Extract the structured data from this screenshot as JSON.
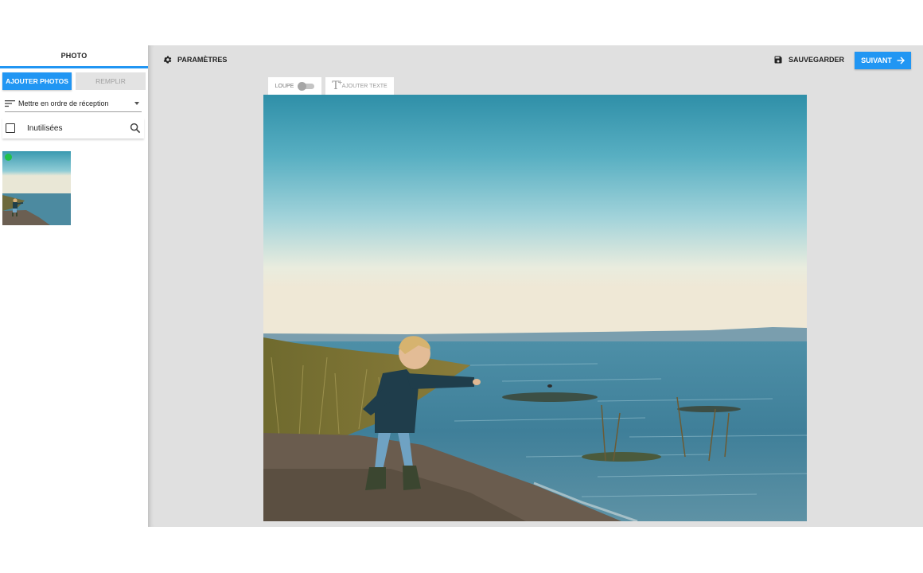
{
  "sidebar": {
    "tab_label": "PHOTO",
    "add_photos_label": "AJOUTER PHOTOS",
    "fill_label": "REMPLIR",
    "sort": {
      "selected": "Mettre en ordre de réception",
      "icon": "sort-icon"
    },
    "filter": {
      "label": "Inutilisées",
      "checked": false,
      "icon": "search-icon"
    },
    "thumbnail": {
      "status_color": "#21c14a"
    }
  },
  "toolbar": {
    "settings_label": "PARAMÈTRES",
    "settings_icon": "gear-icon",
    "save_label": "SAUVEGARDER",
    "save_icon": "floppy-disk-icon",
    "next_label": "SUIVANT",
    "next_icon": "arrow-right-icon"
  },
  "canvas_tools": {
    "loupe_label": "LOUPE",
    "loupe_enabled": false,
    "add_text_label": "AJOUTER TEXTE",
    "add_text_icon": "text-plus-icon"
  },
  "colors": {
    "accent": "#2196f3",
    "workspace_bg": "#e0e0e0",
    "disabled_button_bg": "#e3e3e3"
  }
}
